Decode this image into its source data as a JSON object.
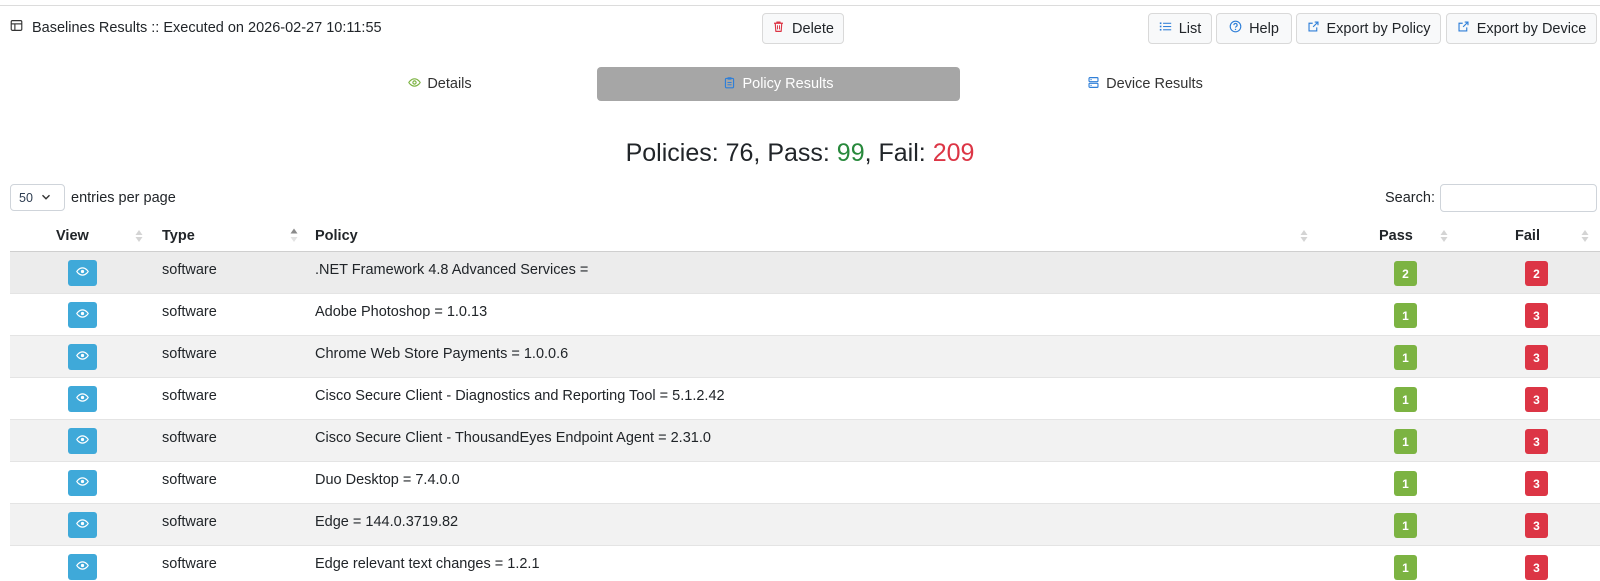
{
  "header": {
    "title": "Baselines Results :: Executed on 2026-02-27 10:11:55",
    "delete_label": "Delete",
    "list_label": "List",
    "help_label": "Help",
    "export_policy_label": "Export by Policy",
    "export_device_label": "Export by Device"
  },
  "tabs": {
    "details": "Details",
    "policy_results": "Policy Results",
    "device_results": "Device Results",
    "active": "Policy Results"
  },
  "summary": {
    "policies_prefix": "Policies: 76, Pass: ",
    "pass": "99",
    "fail_prefix": ", Fail: ",
    "fail": "209"
  },
  "controls": {
    "page_size": "50",
    "page_size_label": "entries per page",
    "search_label": "Search:",
    "search_value": ""
  },
  "table": {
    "columns": [
      "View",
      "Type",
      "Policy",
      "Pass",
      "Fail"
    ],
    "sorted_column": "Type",
    "rows": [
      {
        "type": "software",
        "policy": ".NET Framework 4.8 Advanced Services =",
        "pass": "2",
        "fail": "2"
      },
      {
        "type": "software",
        "policy": "Adobe Photoshop = 1.0.13",
        "pass": "1",
        "fail": "3"
      },
      {
        "type": "software",
        "policy": "Chrome Web Store Payments = 1.0.0.6",
        "pass": "1",
        "fail": "3"
      },
      {
        "type": "software",
        "policy": "Cisco Secure Client - Diagnostics and Reporting Tool = 5.1.2.42",
        "pass": "1",
        "fail": "3"
      },
      {
        "type": "software",
        "policy": "Cisco Secure Client - ThousandEyes Endpoint Agent = 2.31.0",
        "pass": "1",
        "fail": "3"
      },
      {
        "type": "software",
        "policy": "Duo Desktop = 7.4.0.0",
        "pass": "1",
        "fail": "3"
      },
      {
        "type": "software",
        "policy": "Edge = 144.0.3719.82",
        "pass": "1",
        "fail": "3"
      },
      {
        "type": "software",
        "policy": "Edge relevant text changes = 1.2.1",
        "pass": "1",
        "fail": "3"
      }
    ]
  },
  "icons": {
    "title": "table-icon",
    "delete": "trash-icon",
    "list": "list-icon",
    "help": "question-circle-icon",
    "export": "external-link-icon",
    "details": "eye-icon",
    "policy": "clipboard-icon",
    "device": "server-icon",
    "view": "eye-icon"
  },
  "colors": {
    "pass": "#7cb342",
    "fail": "#dc3545",
    "view_button": "#3fa9d9",
    "active_tab": "#a6a6a6",
    "summary_pass": "#28893c"
  }
}
